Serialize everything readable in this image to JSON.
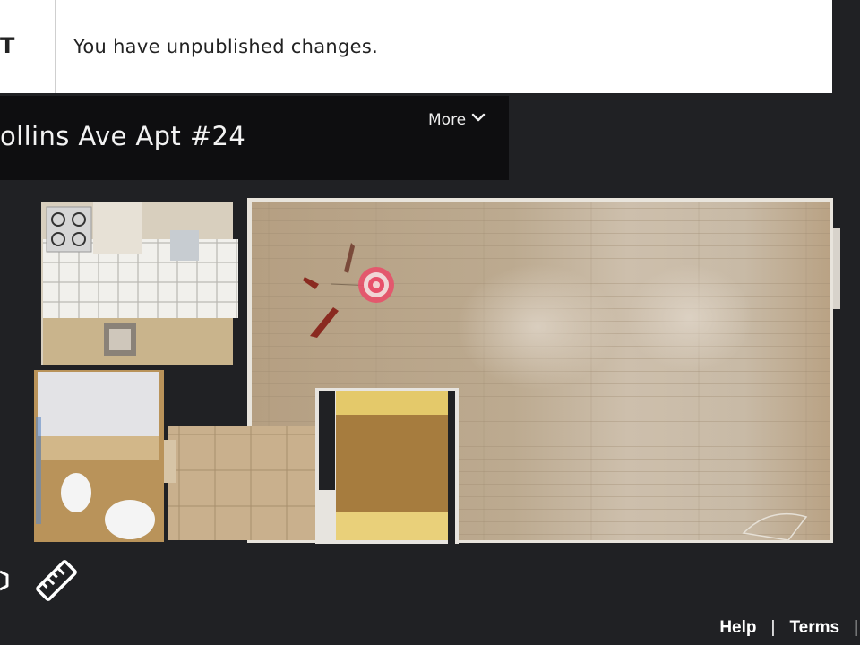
{
  "notice": {
    "edge_letter": "T",
    "message": "You have unpublished changes."
  },
  "header": {
    "title": "ollins Ave Apt #24",
    "more_label": "More"
  },
  "toolbar": {
    "left_icon": "cube-icon",
    "measure_icon": "ruler-icon"
  },
  "footer": {
    "help_label": "Help",
    "separator": "|",
    "terms_label": "Terms"
  },
  "colors": {
    "background": "#202124",
    "titlebar": "#0e0e10",
    "floor_wood": "#b8a488",
    "position_marker": "#e8506a"
  }
}
